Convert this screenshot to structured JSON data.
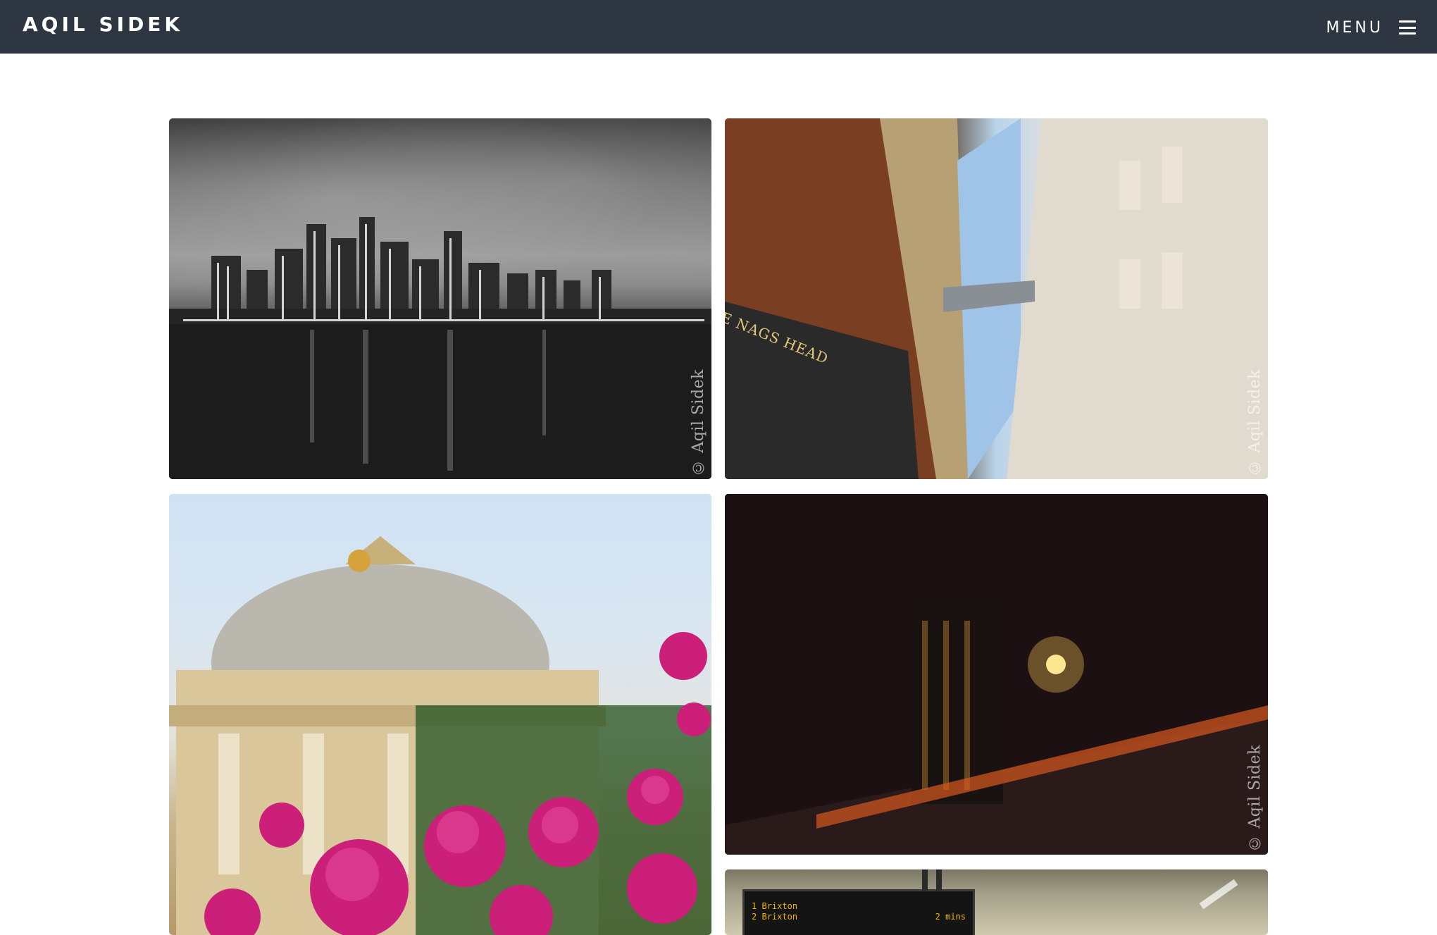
{
  "header": {
    "brand": "AQIL SIDEK",
    "menu_label": "MENU",
    "menu_icon": "hamburger-icon"
  },
  "gallery": {
    "photos": [
      {
        "subject": "nyc-skyline-bw",
        "watermark": "© Aqil Sidek"
      },
      {
        "subject": "london-street-nags-head",
        "watermark": "© Aqil Sidek"
      },
      {
        "subject": "st-pauls-roses",
        "watermark": ""
      },
      {
        "subject": "sunset-window",
        "watermark": "© Aqil Sidek"
      },
      {
        "subject": "tube-station",
        "watermark": ""
      }
    ],
    "p2_sign": "E NAGS HEAD",
    "tube_board": {
      "rows": [
        {
          "num": "1",
          "dest": "Brixton",
          "time": ""
        },
        {
          "num": "2",
          "dest": "Brixton",
          "time": "2 mins"
        }
      ]
    }
  }
}
